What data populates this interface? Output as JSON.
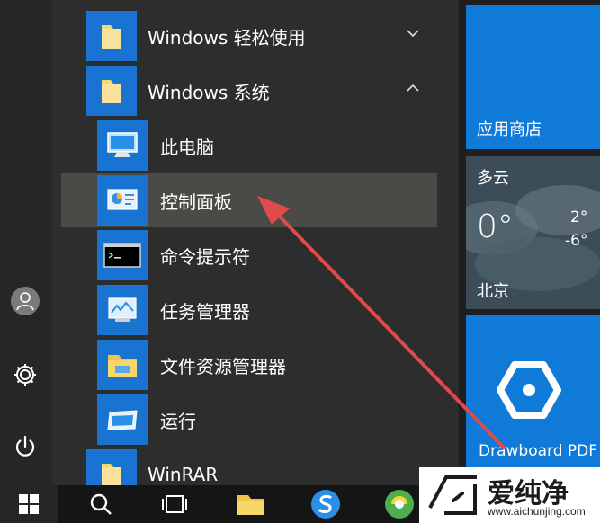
{
  "start_menu": {
    "items": [
      {
        "label": "Windows 轻松使用",
        "icon": "folder-icon"
      },
      {
        "label": "Windows 系统",
        "icon": "folder-icon"
      },
      {
        "label": "此电脑",
        "icon": "computer-icon"
      },
      {
        "label": "控制面板",
        "icon": "control-panel-icon"
      },
      {
        "label": "命令提示符",
        "icon": "command-prompt-icon"
      },
      {
        "label": "任务管理器",
        "icon": "task-manager-icon"
      },
      {
        "label": "文件资源管理器",
        "icon": "file-explorer-icon"
      },
      {
        "label": "运行",
        "icon": "run-icon"
      },
      {
        "label": "WinRAR",
        "icon": "folder-icon"
      }
    ]
  },
  "tiles": {
    "store": {
      "label": "应用商店"
    },
    "weather": {
      "condition": "多云",
      "temp": "0°",
      "high": "2°",
      "low": "-6°",
      "city": "北京"
    },
    "drawboard": {
      "label": "Drawboard PDF"
    }
  },
  "watermark": {
    "name": "爱纯净",
    "url": "www.aichunjing.com"
  },
  "colors": {
    "accent": "#1874d0",
    "highlight": "#4a4a47",
    "arrow": "#e04a4a"
  }
}
